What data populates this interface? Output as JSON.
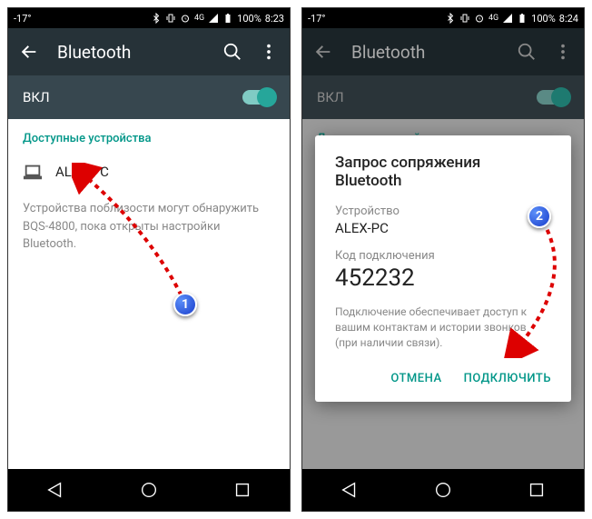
{
  "left": {
    "status": {
      "temp": "-17°",
      "battery": "100%",
      "time": "8:23",
      "network": "4G"
    },
    "header": {
      "title": "Bluetooth"
    },
    "toggle": {
      "label": "ВКЛ"
    },
    "section_header": "Доступные устройства",
    "device_name": "ALEX-PC",
    "info": "Устройства поблизости могут обнаружить BQS-4800, пока открыты настройки Bluetooth."
  },
  "right": {
    "status": {
      "temp": "-17°",
      "battery": "100%",
      "time": "8:24",
      "network": "4G"
    },
    "header": {
      "title": "Bluetooth"
    },
    "toggle": {
      "label": "ВКЛ"
    },
    "section_header": "Доступные устройства",
    "dialog": {
      "title": "Запрос сопряжения Bluetooth",
      "device_label": "Устройство",
      "device_value": "ALEX-PC",
      "code_label": "Код подключения",
      "code_value": "452232",
      "info": "Подключение обеспечивает доступ к вашим контактам и истории звонков (при наличии связи).",
      "cancel": "ОТМЕНА",
      "connect": "ПОДКЛЮЧИТЬ"
    }
  },
  "callouts": {
    "one": "1",
    "two": "2"
  }
}
